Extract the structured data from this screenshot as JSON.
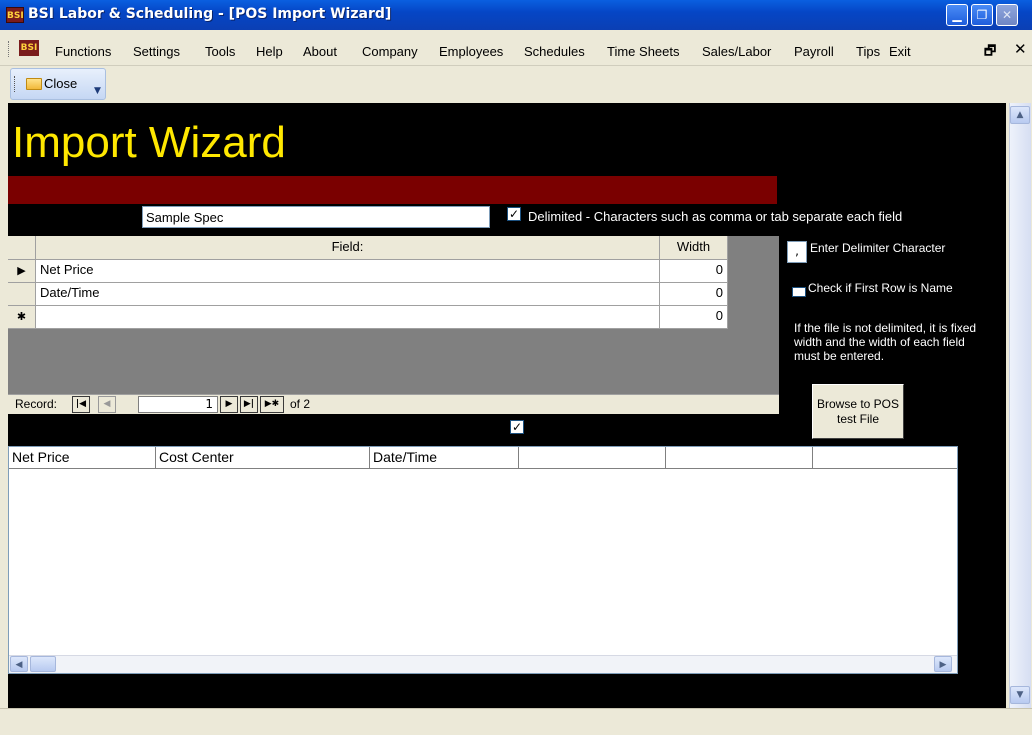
{
  "window": {
    "title": "BSI Labor & Scheduling - [POS Import Wizard]",
    "app_icon": "BSI",
    "controls": {
      "minimize": "▁",
      "maximize": "❐",
      "close": "✕"
    }
  },
  "menu": {
    "app_icon": "BSI",
    "items": [
      "Functions",
      "Settings",
      "Tools",
      "Help",
      "About",
      "Company",
      "Employees",
      "Schedules",
      "Time Sheets",
      "Sales/Labor",
      "Payroll",
      "Tips",
      "Exit"
    ],
    "mdi_restore": "🗗",
    "mdi_close": "✕"
  },
  "toolbar": {
    "close_label": "Close",
    "close_icon": "folder-icon"
  },
  "form": {
    "heading": "Import Wizard",
    "spec_name": "Sample Spec",
    "delimited_checked": true,
    "delimited_label": "Delimited - Characters such as comma or tab separate each field",
    "delimiter_char": ",",
    "delimiter_label": "Enter Delimiter Character",
    "first_row_label": "Check if First Row is Name",
    "info_text": "If the file is not delimited, it is fixed width and the width of each field must be entered.",
    "browse_label": "Browse to POS test File",
    "extra_checked": true,
    "colors": {
      "heading": "#ffe800",
      "red_bar": "#7a0000",
      "background": "#000000"
    }
  },
  "datasheet": {
    "headers": {
      "field": "Field:",
      "width": "Width"
    },
    "rows": [
      {
        "selector": "▶",
        "field": "Net Price",
        "width": "0"
      },
      {
        "selector": "",
        "field": "Date/Time",
        "width": "0"
      },
      {
        "selector": "✱",
        "field": "",
        "width": "0"
      }
    ],
    "nav": {
      "label": "Record:",
      "current": "1",
      "of_text": "of 2",
      "first": "|◀",
      "prev": "◀",
      "next": "▶",
      "last": "▶|",
      "new": "▶✱"
    }
  },
  "preview": {
    "columns": [
      "Net Price",
      "Cost Center",
      "Date/Time",
      "",
      "",
      ""
    ]
  },
  "scrollbars": {
    "up": "▲",
    "down": "▼",
    "left": "◀",
    "right": "▶"
  }
}
